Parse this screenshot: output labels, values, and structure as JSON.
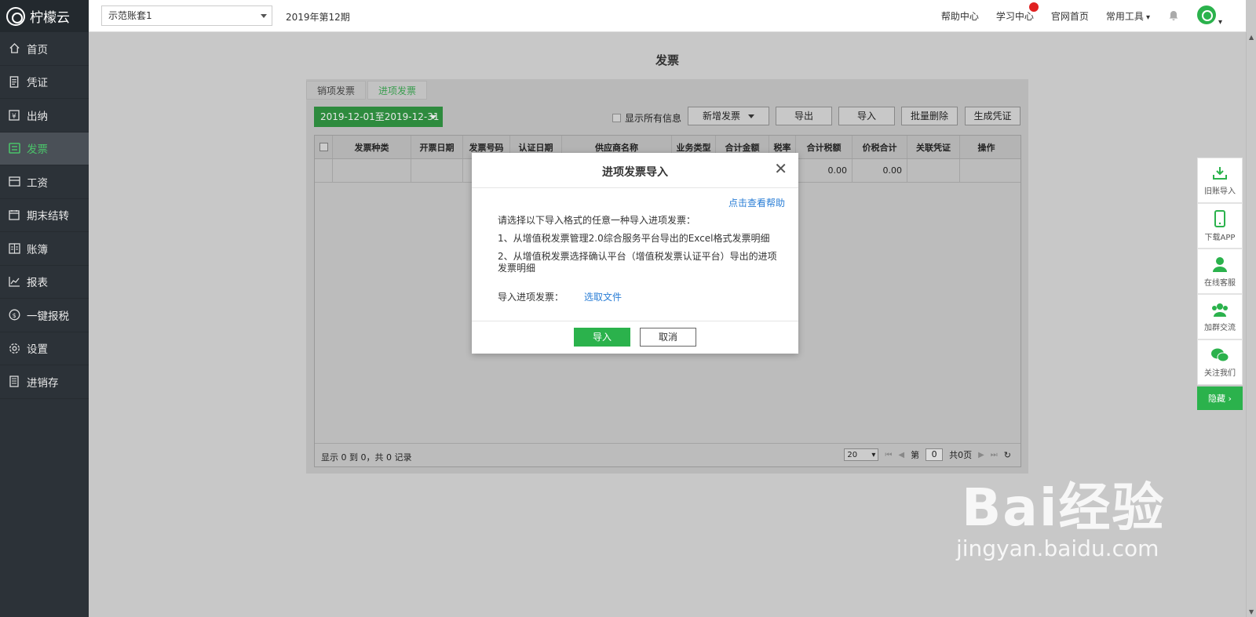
{
  "app": {
    "name": "柠檬云"
  },
  "sidebar": {
    "items": [
      {
        "label": "首页",
        "icon": "home-icon"
      },
      {
        "label": "凭证",
        "icon": "voucher-icon"
      },
      {
        "label": "出纳",
        "icon": "cashier-icon"
      },
      {
        "label": "发票",
        "icon": "invoice-icon",
        "active": true
      },
      {
        "label": "工资",
        "icon": "salary-icon"
      },
      {
        "label": "期末结转",
        "icon": "calendar-icon"
      },
      {
        "label": "账簿",
        "icon": "ledger-icon"
      },
      {
        "label": "报表",
        "icon": "chart-icon"
      },
      {
        "label": "一键报税",
        "icon": "tax-icon"
      },
      {
        "label": "设置",
        "icon": "gear-icon"
      },
      {
        "label": "进销存",
        "icon": "inventory-icon"
      }
    ]
  },
  "topbar": {
    "account": "示范账套1",
    "period": "2019年第12期",
    "links": [
      "帮助中心",
      "学习中心",
      "官网首页",
      "常用工具"
    ]
  },
  "page": {
    "title": "发票",
    "tabs": [
      "销项发票",
      "进项发票"
    ],
    "active_tab": 1
  },
  "toolbar": {
    "date_range": "2019-12-01至2019-12-31",
    "show_all": "显示所有信息",
    "new_invoice": "新增发票",
    "export": "导出",
    "import": "导入",
    "batch_delete": "批量删除",
    "generate_voucher": "生成凭证"
  },
  "table": {
    "columns": [
      "发票种类",
      "开票日期",
      "发票号码",
      "认证日期",
      "供应商名称",
      "业务类型",
      "合计金额",
      "税率",
      "合计税额",
      "价税合计",
      "关联凭证",
      "操作"
    ],
    "totals": {
      "tax": "0.00",
      "total": "0.00"
    },
    "summary": "显示 0 到 0，共 0 记录",
    "page_size": "20",
    "page_prefix": "第",
    "page_num": "0",
    "page_total": "共0页"
  },
  "floatbar": {
    "items": [
      "旧账导入",
      "下载APP",
      "在线客服",
      "加群交流",
      "关注我们"
    ],
    "hide": "隐藏 ›"
  },
  "modal": {
    "title": "进项发票导入",
    "help": "点击查看帮助",
    "intro": "请选择以下导入格式的任意一种导入进项发票：",
    "option1": "1、从增值税发票管理2.0综合服务平台导出的Excel格式发票明细",
    "option2": "2、从增值税发票选择确认平台（增值税发票认证平台）导出的进项发票明细",
    "file_label": "导入进项发票：",
    "file_link": "选取文件",
    "ok": "导入",
    "cancel": "取消"
  },
  "watermark": {
    "big": "Bai经验",
    "small": "jingyan.baidu.com"
  }
}
